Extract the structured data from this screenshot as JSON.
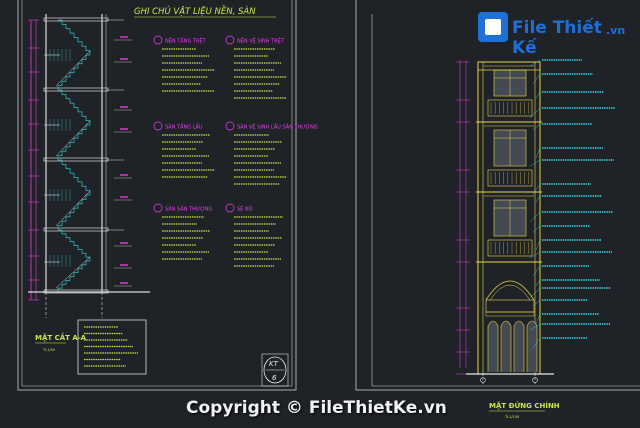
{
  "left_sheet": {
    "title": "GHI CHÚ VẬT LIỆU NỀN, SÀN",
    "section_title": "MẶT CẮT A-A",
    "section_scale": "TL1/50",
    "sheet_number": "KT",
    "sheet_index": "6",
    "notes": [
      {
        "heading": "NỀN TẦNG TRỆT"
      },
      {
        "heading": "NỀN VỆ SINH TRỆT"
      },
      {
        "heading": "SÀN TẦNG LẦU"
      },
      {
        "heading": "SÀN VỆ SINH LẦU SÂN THƯỢNG"
      },
      {
        "heading": "SÂN SÂN THƯỢNG"
      },
      {
        "heading": "SÊ NÔ"
      }
    ]
  },
  "right_sheet": {
    "title": "MẶT ĐỨNG CHÍNH",
    "scale": "TL1/100"
  },
  "watermark": {
    "logo_text": "File Thiết Kế",
    "logo_suffix": ".vn",
    "copyright": "Copyright © FileThietKe.vn"
  },
  "colors": {
    "background": "#1f2328",
    "frame": "#a8a8a8",
    "section_lines": "#d9d9d9",
    "dimension": "#e23bd7",
    "notes_text": "#c7e64a",
    "notes_heading": "#e93cf0",
    "stairs": "#2ec2c9",
    "facade_frame": "#e8d24a",
    "leader_text": "#2ed7e0",
    "window_fill": "#444a52"
  }
}
